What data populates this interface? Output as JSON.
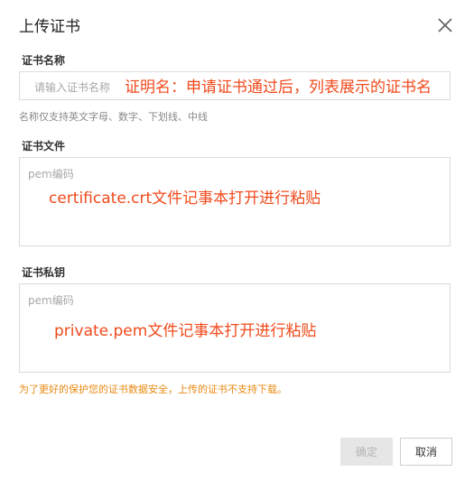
{
  "dialog": {
    "title": "上传证书",
    "close_icon": "close-icon"
  },
  "cert_name": {
    "label": "证书名称",
    "placeholder": "请输入证书名称",
    "annotation": "证明名：申请证书通过后，列表展示的证书名",
    "hint": "名称仅支持英文字母、数字、下划线、中线"
  },
  "cert_file": {
    "label": "证书文件",
    "placeholder": "pem编码",
    "annotation": "certificate.crt文件记事本打开进行粘贴"
  },
  "cert_key": {
    "label": "证书私钥",
    "placeholder": "pem编码",
    "annotation": "private.pem文件记事本打开进行粘贴"
  },
  "warning": "为了更好的保护您的证书数据安全，上传的证书不支持下载。",
  "buttons": {
    "confirm": "确定",
    "cancel": "取消"
  },
  "colors": {
    "annotation": "#f04a1c",
    "warning": "#e88a12",
    "disabled_button_bg": "#e6e6e6"
  }
}
